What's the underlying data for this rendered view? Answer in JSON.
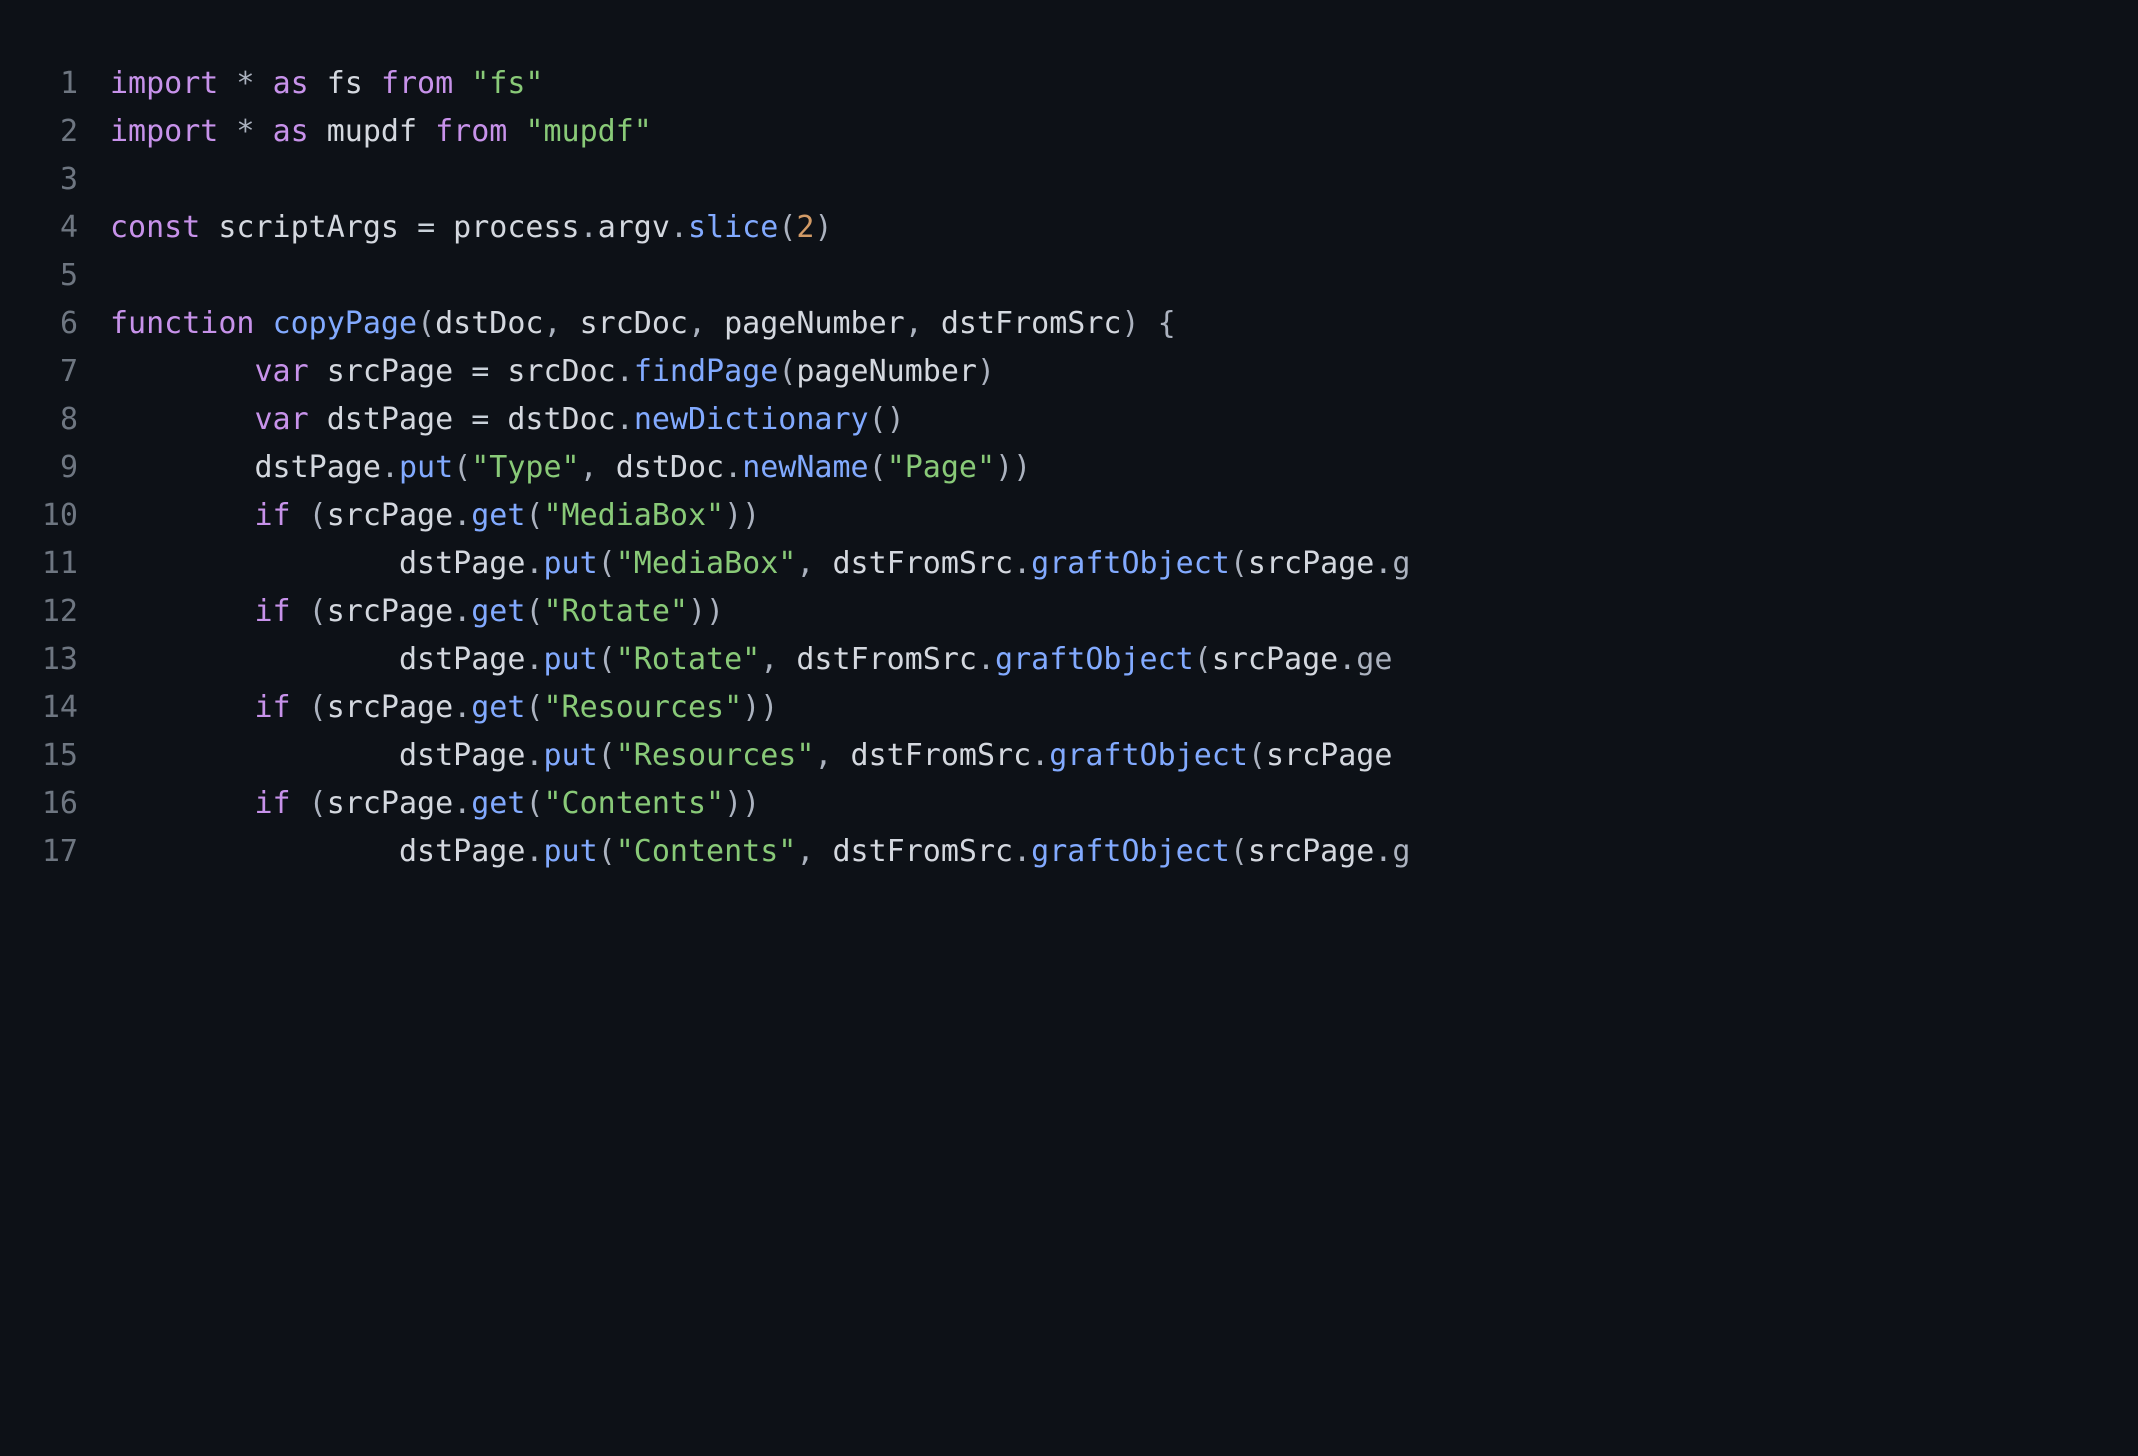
{
  "lines": [
    {
      "num": "1",
      "tokens": [
        {
          "c": "kw",
          "t": "import"
        },
        {
          "c": "punct",
          "t": " * "
        },
        {
          "c": "kw",
          "t": "as"
        },
        {
          "c": "ident",
          "t": " fs "
        },
        {
          "c": "kw",
          "t": "from"
        },
        {
          "c": "punct",
          "t": " "
        },
        {
          "c": "str",
          "t": "\"fs\""
        }
      ]
    },
    {
      "num": "2",
      "tokens": [
        {
          "c": "kw",
          "t": "import"
        },
        {
          "c": "punct",
          "t": " * "
        },
        {
          "c": "kw",
          "t": "as"
        },
        {
          "c": "ident",
          "t": " mupdf "
        },
        {
          "c": "kw",
          "t": "from"
        },
        {
          "c": "punct",
          "t": " "
        },
        {
          "c": "str",
          "t": "\"mupdf\""
        }
      ]
    },
    {
      "num": "3",
      "tokens": [
        {
          "c": "punct",
          "t": ""
        }
      ]
    },
    {
      "num": "4",
      "tokens": [
        {
          "c": "kw",
          "t": "const"
        },
        {
          "c": "ident",
          "t": " scriptArgs "
        },
        {
          "c": "op",
          "t": "="
        },
        {
          "c": "ident",
          "t": " process"
        },
        {
          "c": "punct",
          "t": "."
        },
        {
          "c": "ident",
          "t": "argv"
        },
        {
          "c": "punct",
          "t": "."
        },
        {
          "c": "fn",
          "t": "slice"
        },
        {
          "c": "punct",
          "t": "("
        },
        {
          "c": "num",
          "t": "2"
        },
        {
          "c": "punct",
          "t": ")"
        }
      ]
    },
    {
      "num": "5",
      "tokens": [
        {
          "c": "punct",
          "t": ""
        }
      ]
    },
    {
      "num": "6",
      "tokens": [
        {
          "c": "kw",
          "t": "function"
        },
        {
          "c": "punct",
          "t": " "
        },
        {
          "c": "fn",
          "t": "copyPage"
        },
        {
          "c": "punct",
          "t": "("
        },
        {
          "c": "ident",
          "t": "dstDoc"
        },
        {
          "c": "punct",
          "t": ", "
        },
        {
          "c": "ident",
          "t": "srcDoc"
        },
        {
          "c": "punct",
          "t": ", "
        },
        {
          "c": "ident",
          "t": "pageNumber"
        },
        {
          "c": "punct",
          "t": ", "
        },
        {
          "c": "ident",
          "t": "dstFromSrc"
        },
        {
          "c": "punct",
          "t": ") {"
        }
      ]
    },
    {
      "num": "7",
      "tokens": [
        {
          "c": "punct",
          "t": "        "
        },
        {
          "c": "kw",
          "t": "var"
        },
        {
          "c": "ident",
          "t": " srcPage "
        },
        {
          "c": "op",
          "t": "="
        },
        {
          "c": "ident",
          "t": " srcDoc"
        },
        {
          "c": "punct",
          "t": "."
        },
        {
          "c": "fn",
          "t": "findPage"
        },
        {
          "c": "punct",
          "t": "("
        },
        {
          "c": "ident",
          "t": "pageNumber"
        },
        {
          "c": "punct",
          "t": ")"
        }
      ]
    },
    {
      "num": "8",
      "tokens": [
        {
          "c": "punct",
          "t": "        "
        },
        {
          "c": "kw",
          "t": "var"
        },
        {
          "c": "ident",
          "t": " dstPage "
        },
        {
          "c": "op",
          "t": "="
        },
        {
          "c": "ident",
          "t": " dstDoc"
        },
        {
          "c": "punct",
          "t": "."
        },
        {
          "c": "fn",
          "t": "newDictionary"
        },
        {
          "c": "punct",
          "t": "()"
        }
      ]
    },
    {
      "num": "9",
      "tokens": [
        {
          "c": "punct",
          "t": "        "
        },
        {
          "c": "ident",
          "t": "dstPage"
        },
        {
          "c": "punct",
          "t": "."
        },
        {
          "c": "fn",
          "t": "put"
        },
        {
          "c": "punct",
          "t": "("
        },
        {
          "c": "str",
          "t": "\"Type\""
        },
        {
          "c": "punct",
          "t": ", "
        },
        {
          "c": "ident",
          "t": "dstDoc"
        },
        {
          "c": "punct",
          "t": "."
        },
        {
          "c": "fn",
          "t": "newName"
        },
        {
          "c": "punct",
          "t": "("
        },
        {
          "c": "str",
          "t": "\"Page\""
        },
        {
          "c": "punct",
          "t": "))"
        }
      ]
    },
    {
      "num": "10",
      "tokens": [
        {
          "c": "punct",
          "t": "        "
        },
        {
          "c": "kw",
          "t": "if"
        },
        {
          "c": "punct",
          "t": " ("
        },
        {
          "c": "ident",
          "t": "srcPage"
        },
        {
          "c": "punct",
          "t": "."
        },
        {
          "c": "fn",
          "t": "get"
        },
        {
          "c": "punct",
          "t": "("
        },
        {
          "c": "str",
          "t": "\"MediaBox\""
        },
        {
          "c": "punct",
          "t": "))"
        }
      ]
    },
    {
      "num": "11",
      "tokens": [
        {
          "c": "punct",
          "t": "                "
        },
        {
          "c": "ident",
          "t": "dstPage"
        },
        {
          "c": "punct",
          "t": "."
        },
        {
          "c": "fn",
          "t": "put"
        },
        {
          "c": "punct",
          "t": "("
        },
        {
          "c": "str",
          "t": "\"MediaBox\""
        },
        {
          "c": "punct",
          "t": ", "
        },
        {
          "c": "ident",
          "t": "dstFromSrc"
        },
        {
          "c": "punct",
          "t": "."
        },
        {
          "c": "fn",
          "t": "graftObject"
        },
        {
          "c": "punct",
          "t": "("
        },
        {
          "c": "ident",
          "t": "srcPage"
        },
        {
          "c": "punct",
          "t": ".g"
        }
      ]
    },
    {
      "num": "12",
      "tokens": [
        {
          "c": "punct",
          "t": "        "
        },
        {
          "c": "kw",
          "t": "if"
        },
        {
          "c": "punct",
          "t": " ("
        },
        {
          "c": "ident",
          "t": "srcPage"
        },
        {
          "c": "punct",
          "t": "."
        },
        {
          "c": "fn",
          "t": "get"
        },
        {
          "c": "punct",
          "t": "("
        },
        {
          "c": "str",
          "t": "\"Rotate\""
        },
        {
          "c": "punct",
          "t": "))"
        }
      ]
    },
    {
      "num": "13",
      "tokens": [
        {
          "c": "punct",
          "t": "                "
        },
        {
          "c": "ident",
          "t": "dstPage"
        },
        {
          "c": "punct",
          "t": "."
        },
        {
          "c": "fn",
          "t": "put"
        },
        {
          "c": "punct",
          "t": "("
        },
        {
          "c": "str",
          "t": "\"Rotate\""
        },
        {
          "c": "punct",
          "t": ", "
        },
        {
          "c": "ident",
          "t": "dstFromSrc"
        },
        {
          "c": "punct",
          "t": "."
        },
        {
          "c": "fn",
          "t": "graftObject"
        },
        {
          "c": "punct",
          "t": "("
        },
        {
          "c": "ident",
          "t": "srcPage"
        },
        {
          "c": "punct",
          "t": ".ge"
        }
      ]
    },
    {
      "num": "14",
      "tokens": [
        {
          "c": "punct",
          "t": "        "
        },
        {
          "c": "kw",
          "t": "if"
        },
        {
          "c": "punct",
          "t": " ("
        },
        {
          "c": "ident",
          "t": "srcPage"
        },
        {
          "c": "punct",
          "t": "."
        },
        {
          "c": "fn",
          "t": "get"
        },
        {
          "c": "punct",
          "t": "("
        },
        {
          "c": "str",
          "t": "\"Resources\""
        },
        {
          "c": "punct",
          "t": "))"
        }
      ]
    },
    {
      "num": "15",
      "tokens": [
        {
          "c": "punct",
          "t": "                "
        },
        {
          "c": "ident",
          "t": "dstPage"
        },
        {
          "c": "punct",
          "t": "."
        },
        {
          "c": "fn",
          "t": "put"
        },
        {
          "c": "punct",
          "t": "("
        },
        {
          "c": "str",
          "t": "\"Resources\""
        },
        {
          "c": "punct",
          "t": ", "
        },
        {
          "c": "ident",
          "t": "dstFromSrc"
        },
        {
          "c": "punct",
          "t": "."
        },
        {
          "c": "fn",
          "t": "graftObject"
        },
        {
          "c": "punct",
          "t": "("
        },
        {
          "c": "ident",
          "t": "srcPage"
        }
      ]
    },
    {
      "num": "16",
      "tokens": [
        {
          "c": "punct",
          "t": "        "
        },
        {
          "c": "kw",
          "t": "if"
        },
        {
          "c": "punct",
          "t": " ("
        },
        {
          "c": "ident",
          "t": "srcPage"
        },
        {
          "c": "punct",
          "t": "."
        },
        {
          "c": "fn",
          "t": "get"
        },
        {
          "c": "punct",
          "t": "("
        },
        {
          "c": "str",
          "t": "\"Contents\""
        },
        {
          "c": "punct",
          "t": "))"
        }
      ]
    },
    {
      "num": "17",
      "tokens": [
        {
          "c": "punct",
          "t": "                "
        },
        {
          "c": "ident",
          "t": "dstPage"
        },
        {
          "c": "punct",
          "t": "."
        },
        {
          "c": "fn",
          "t": "put"
        },
        {
          "c": "punct",
          "t": "("
        },
        {
          "c": "str",
          "t": "\"Contents\""
        },
        {
          "c": "punct",
          "t": ", "
        },
        {
          "c": "ident",
          "t": "dstFromSrc"
        },
        {
          "c": "punct",
          "t": "."
        },
        {
          "c": "fn",
          "t": "graftObject"
        },
        {
          "c": "punct",
          "t": "("
        },
        {
          "c": "ident",
          "t": "srcPage"
        },
        {
          "c": "punct",
          "t": ".g"
        }
      ]
    }
  ]
}
